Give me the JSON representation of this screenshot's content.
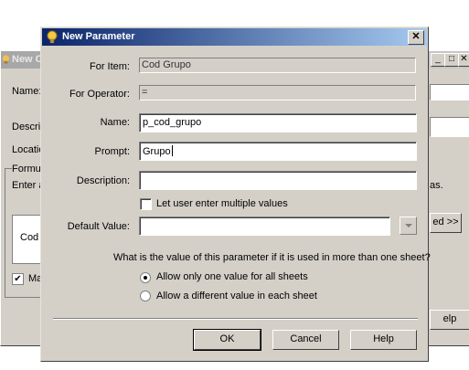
{
  "background_dialog": {
    "title": "New C",
    "labels": {
      "name": "Name:",
      "description": "Descri",
      "location": "Locatio",
      "formula": "Formul",
      "enter": "Enter a",
      "tail_text": "as.",
      "list_item": "Cod",
      "check_label": "Ma"
    },
    "buttons": {
      "advanced": "ed >>",
      "help": "elp"
    }
  },
  "dialog": {
    "title": "New Parameter",
    "close_label": "✕",
    "fields": {
      "for_item": {
        "label": "For Item:",
        "value": "Cod Grupo"
      },
      "for_operator": {
        "label": "For Operator:",
        "value": "="
      },
      "name": {
        "label": "Name:",
        "value": "p_cod_grupo"
      },
      "prompt": {
        "label": "Prompt:",
        "value": "Grupo"
      },
      "description": {
        "label": "Description:",
        "value": ""
      },
      "default_value": {
        "label": "Default Value:",
        "value": ""
      }
    },
    "multiple_values": {
      "label": "Let user enter multiple values",
      "checked": false
    },
    "question": "What is the value of this parameter if it is used in more than one sheet?",
    "options": [
      {
        "label": "Allow only one value for all sheets",
        "selected": true
      },
      {
        "label": "Allow a different value in each sheet",
        "selected": false
      }
    ],
    "buttons": {
      "ok": "OK",
      "cancel": "Cancel",
      "help": "Help"
    }
  },
  "colors": {
    "title_start": "#0a246a",
    "title_end": "#a6caf0",
    "face": "#d4d0c8"
  },
  "icons": {
    "title": "lightbulb-icon",
    "close": "close-icon",
    "dropdown": "chevron-down-icon"
  }
}
